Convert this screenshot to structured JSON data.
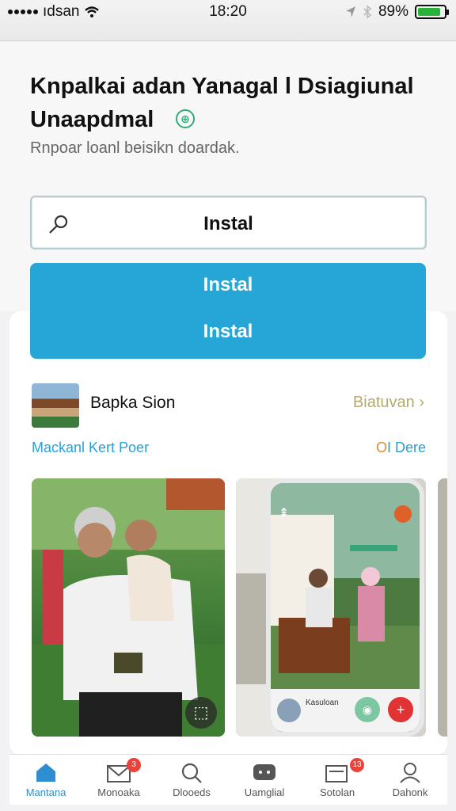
{
  "status_bar": {
    "carrier": "ıdsan",
    "time": "18:20",
    "battery_text": "89%",
    "battery_level": 0.89,
    "battery_color": "#27b33a"
  },
  "header": {
    "title": "Knpalkai adan Yanagal l Dsiagiunal Unaapdmal",
    "subtitle": "Rnpoar loanl beisikn doardak."
  },
  "install_outline": {
    "label": "Instal"
  },
  "install_solid": {
    "label_1": "Instal",
    "label_2": "Instal",
    "color": "#25a6d6"
  },
  "app": {
    "name": "Bapka Sion",
    "link": "Biatuvan"
  },
  "links": {
    "left": "Mackanl Kert Poer",
    "right_prefix": "O",
    "right_rest": "I Dere"
  },
  "photo_card": {
    "phone_label": "Kasuloan"
  },
  "tabs": [
    {
      "label": "Mantana",
      "icon": "home-icon",
      "active": true
    },
    {
      "label": "Monoaka",
      "icon": "mail-icon",
      "badge": "3"
    },
    {
      "label": "Dlooeds",
      "icon": "search-icon"
    },
    {
      "label": "Uamglial",
      "icon": "chat-icon"
    },
    {
      "label": "Sotolan",
      "icon": "message-icon",
      "badge": "13"
    },
    {
      "label": "Dahonk",
      "icon": "profile-icon"
    }
  ]
}
